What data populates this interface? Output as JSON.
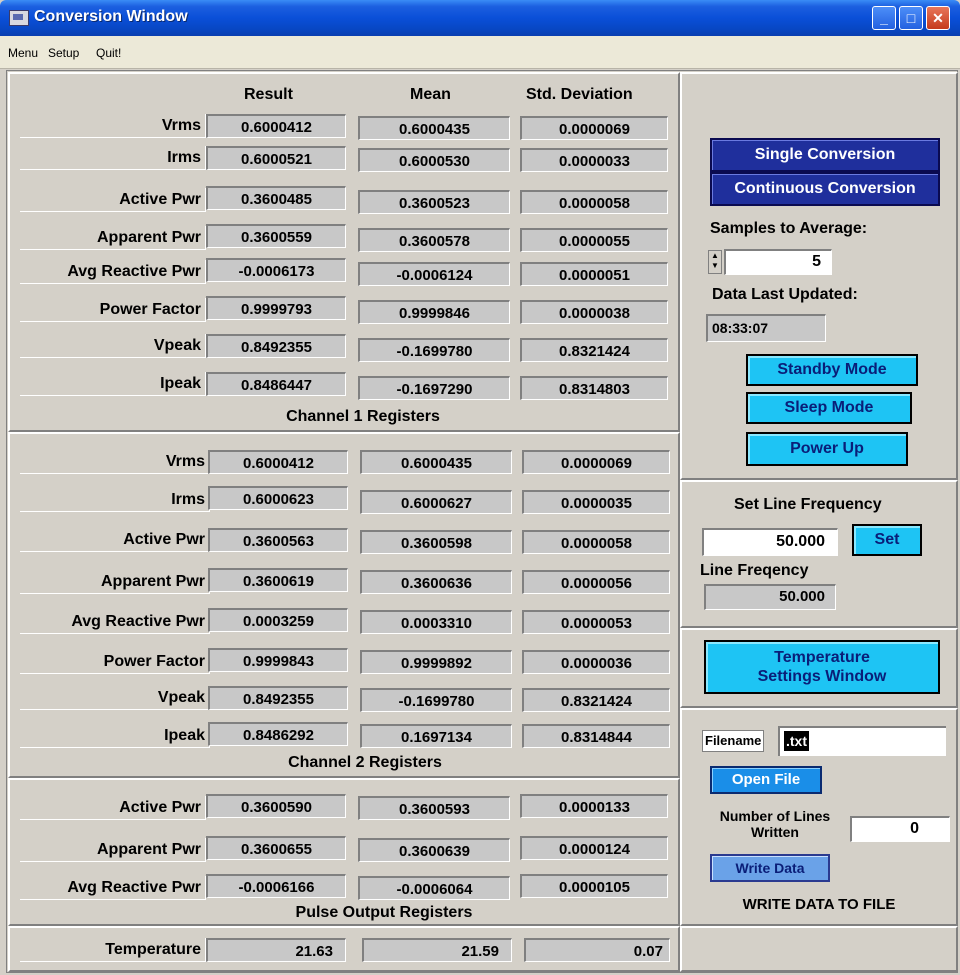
{
  "window": {
    "title": "Conversion Window"
  },
  "menu": {
    "items": [
      "Menu",
      "Setup",
      "Quit!"
    ]
  },
  "columns": [
    "Result",
    "Mean",
    "Std. Deviation"
  ],
  "channel1": {
    "title": "Channel 1 Registers",
    "rows": [
      {
        "label": "Vrms",
        "result": "0.6000412",
        "mean": "0.6000435",
        "std": "0.0000069"
      },
      {
        "label": "Irms",
        "result": "0.6000521",
        "mean": "0.6000530",
        "std": "0.0000033"
      },
      {
        "label": "Active Pwr",
        "result": "0.3600485",
        "mean": "0.3600523",
        "std": "0.0000058"
      },
      {
        "label": "Apparent Pwr",
        "result": "0.3600559",
        "mean": "0.3600578",
        "std": "0.0000055"
      },
      {
        "label": "Avg Reactive Pwr",
        "result": "-0.0006173",
        "mean": "-0.0006124",
        "std": "0.0000051"
      },
      {
        "label": "Power Factor",
        "result": "0.9999793",
        "mean": "0.9999846",
        "std": "0.0000038"
      },
      {
        "label": "Vpeak",
        "result": "0.8492355",
        "mean": "-0.1699780",
        "std": "0.8321424"
      },
      {
        "label": "Ipeak",
        "result": "0.8486447",
        "mean": "-0.1697290",
        "std": "0.8314803"
      }
    ]
  },
  "channel2": {
    "title": "Channel 2 Registers",
    "rows": [
      {
        "label": "Vrms",
        "result": "0.6000412",
        "mean": "0.6000435",
        "std": "0.0000069"
      },
      {
        "label": "Irms",
        "result": "0.6000623",
        "mean": "0.6000627",
        "std": "0.0000035"
      },
      {
        "label": "Active Pwr",
        "result": "0.3600563",
        "mean": "0.3600598",
        "std": "0.0000058"
      },
      {
        "label": "Apparent Pwr",
        "result": "0.3600619",
        "mean": "0.3600636",
        "std": "0.0000056"
      },
      {
        "label": "Avg Reactive Pwr",
        "result": "0.0003259",
        "mean": "0.0003310",
        "std": "0.0000053"
      },
      {
        "label": "Power Factor",
        "result": "0.9999843",
        "mean": "0.9999892",
        "std": "0.0000036"
      },
      {
        "label": "Vpeak",
        "result": "0.8492355",
        "mean": "-0.1699780",
        "std": "0.8321424"
      },
      {
        "label": "Ipeak",
        "result": "0.8486292",
        "mean": "0.1697134",
        "std": "0.8314844"
      }
    ]
  },
  "pulse": {
    "title": "Pulse Output Registers",
    "rows": [
      {
        "label": "Active Pwr",
        "result": "0.3600590",
        "mean": "0.3600593",
        "std": "0.0000133"
      },
      {
        "label": "Apparent Pwr",
        "result": "0.3600655",
        "mean": "0.3600639",
        "std": "0.0000124"
      },
      {
        "label": "Avg Reactive Pwr",
        "result": "-0.0006166",
        "mean": "-0.0006064",
        "std": "0.0000105"
      }
    ]
  },
  "temperature": {
    "label": "Temperature",
    "result": "21.63",
    "mean": "21.59",
    "std": "0.07"
  },
  "controls": {
    "single_conversion": "Single Conversion",
    "continuous_conversion": "Continuous Conversion",
    "samples_label": "Samples to Average:",
    "samples_value": "5",
    "data_updated_label": "Data Last Updated:",
    "data_updated_value": "08:33:07",
    "standby": "Standby Mode",
    "sleep": "Sleep Mode",
    "power_up": "Power Up"
  },
  "line_freq": {
    "set_label": "Set Line Frequency",
    "input_value": "50.000",
    "set_button": "Set",
    "readout_label": "Line Freqency",
    "readout_value": "50.000"
  },
  "temp_window": {
    "line1": "Temperature",
    "line2": "Settings Window"
  },
  "file": {
    "filename_label": "Filename",
    "filename_value": ".txt",
    "open_file": "Open File",
    "lines_label_1": "Number of Lines",
    "lines_label_2": "Written",
    "lines_value": "0",
    "write_data": "Write Data",
    "caption": "WRITE DATA TO FILE"
  }
}
